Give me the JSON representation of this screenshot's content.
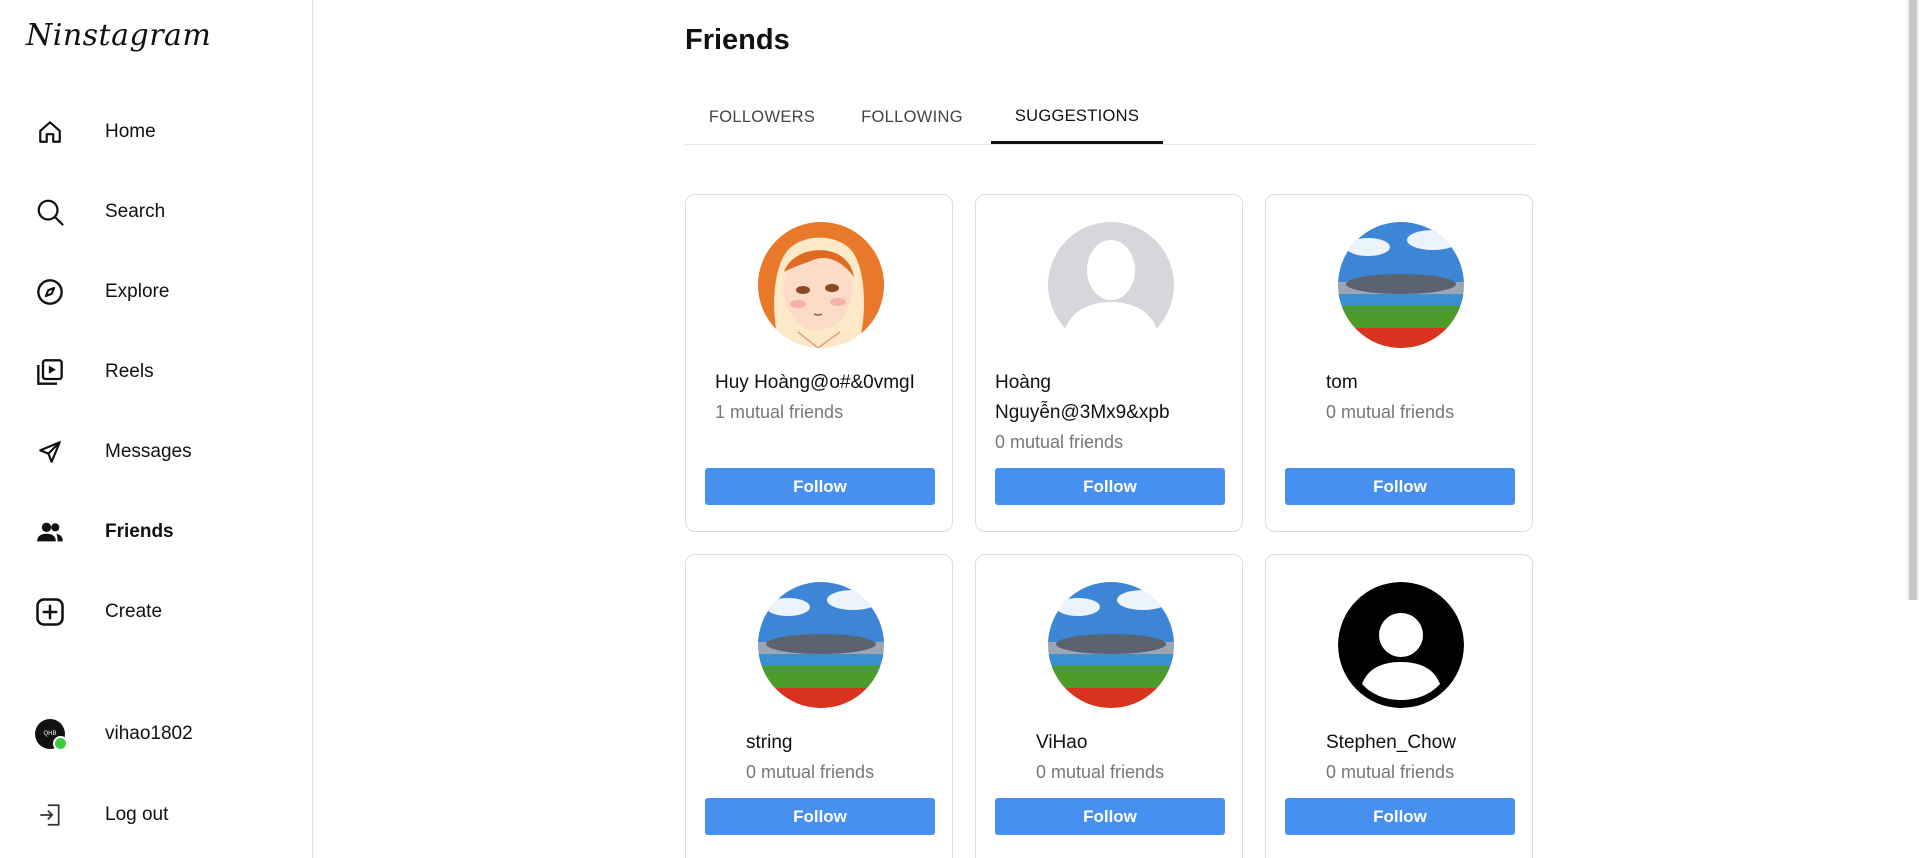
{
  "app": {
    "logo": "Ninstagram"
  },
  "sidebar": {
    "items": [
      {
        "label": "Home",
        "icon": "home-icon"
      },
      {
        "label": "Search",
        "icon": "search-icon"
      },
      {
        "label": "Explore",
        "icon": "compass-icon"
      },
      {
        "label": "Reels",
        "icon": "reels-icon"
      },
      {
        "label": "Messages",
        "icon": "send-icon"
      },
      {
        "label": "Friends",
        "icon": "friends-icon",
        "active": true
      },
      {
        "label": "Create",
        "icon": "plus-square-icon"
      }
    ],
    "profile": {
      "username": "vihao1802",
      "avatar_text": "QHB",
      "status": "online"
    },
    "logout": {
      "label": "Log out",
      "icon": "logout-icon"
    }
  },
  "main": {
    "title": "Friends",
    "tabs": [
      {
        "label": "FOLLOWERS"
      },
      {
        "label": "FOLLOWING"
      },
      {
        "label": "SUGGESTIONS",
        "active": true
      }
    ],
    "suggestions": [
      {
        "name": "Huy Hoàng@o#&0vmgI",
        "mutual": "1 mutual friends",
        "avatar": "anime-girl",
        "button": "Follow"
      },
      {
        "name_line1": "Hoàng",
        "name_line2": "Nguyễn@3Mx9&xpb",
        "mutual": "0 mutual friends",
        "avatar": "default-grey",
        "button": "Follow"
      },
      {
        "name": "tom",
        "mutual": "0 mutual friends",
        "avatar": "stadium",
        "button": "Follow"
      },
      {
        "name": "string",
        "mutual": "0 mutual friends",
        "avatar": "stadium",
        "button": "Follow"
      },
      {
        "name": "ViHao",
        "mutual": "0 mutual friends",
        "avatar": "stadium",
        "button": "Follow"
      },
      {
        "name": "Stephen_Chow",
        "mutual": "0 mutual friends",
        "avatar": "default-black",
        "button": "Follow"
      }
    ]
  },
  "colors": {
    "follow_button": "#4790f0",
    "status_online": "#3ccc44",
    "border": "#dcdcdc"
  }
}
